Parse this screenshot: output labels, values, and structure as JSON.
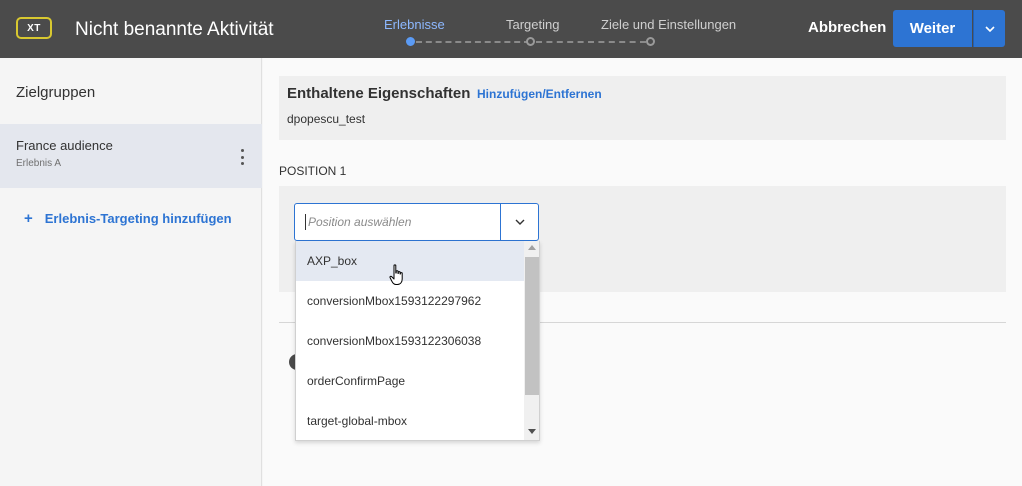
{
  "header": {
    "badge": "XT",
    "title": "Nicht benannte Aktivität",
    "steps": [
      {
        "label": "Erlebnisse",
        "active": true
      },
      {
        "label": "Targeting",
        "active": false
      },
      {
        "label": "Ziele und Einstellungen",
        "active": false
      }
    ],
    "cancel_label": "Abbrechen",
    "next_label": "Weiter"
  },
  "sidebar": {
    "heading": "Zielgruppen",
    "audiences": [
      {
        "name": "France audience",
        "experience": "Erlebnis A"
      }
    ],
    "add_targeting_label": "Erlebnis-Targeting hinzufügen"
  },
  "main": {
    "properties": {
      "title": "Enthaltene Eigenschaften",
      "link_label": "Hinzufügen/Entfernen",
      "value": "dpopescu_test"
    },
    "position_label": "POSITION 1",
    "position_select": {
      "placeholder": "Position auswählen",
      "options": [
        "AXP_box",
        "conversionMbox1593122297962",
        "conversionMbox1593122306038",
        "orderConfirmPage",
        "target-global-mbox"
      ],
      "hovered_index": 0
    }
  },
  "colors": {
    "topbar": "#4b4b4b",
    "accent": "#2d74d3",
    "active_step": "#8db8ff",
    "badge_border": "#d8c830"
  }
}
